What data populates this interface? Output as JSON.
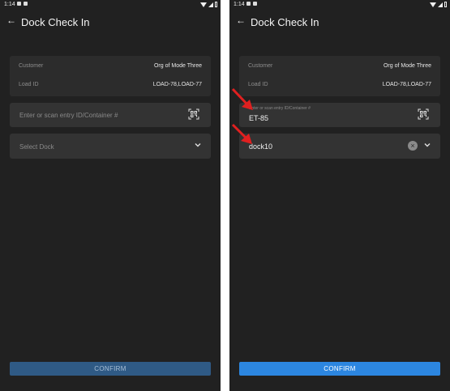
{
  "status_bar": {
    "time": "1:14"
  },
  "screens": [
    {
      "title": "Dock Check In",
      "info": {
        "customer_label": "Customer",
        "customer_value": "Org of Mode Three",
        "load_label": "Load ID",
        "load_value": "LOAD-78,LOAD-77"
      },
      "entry": {
        "placeholder": "Enter or scan entry ID/Container #"
      },
      "dock": {
        "placeholder": "Select Dock"
      },
      "confirm_label": "CONFIRM"
    },
    {
      "title": "Dock Check In",
      "info": {
        "customer_label": "Customer",
        "customer_value": "Org of Mode Three",
        "load_label": "Load ID",
        "load_value": "LOAD-78,LOAD-77"
      },
      "entry": {
        "floating_label": "Enter or scan entry ID/Container #",
        "value": "ET-85"
      },
      "dock": {
        "value": "dock10"
      },
      "confirm_label": "CONFIRM"
    }
  ],
  "colors": {
    "background": "#212121",
    "card": "#2c2c2c",
    "confirm_disabled": "#2f5a85",
    "confirm_enabled": "#2c86e0",
    "annotation_arrow": "#e02020"
  }
}
